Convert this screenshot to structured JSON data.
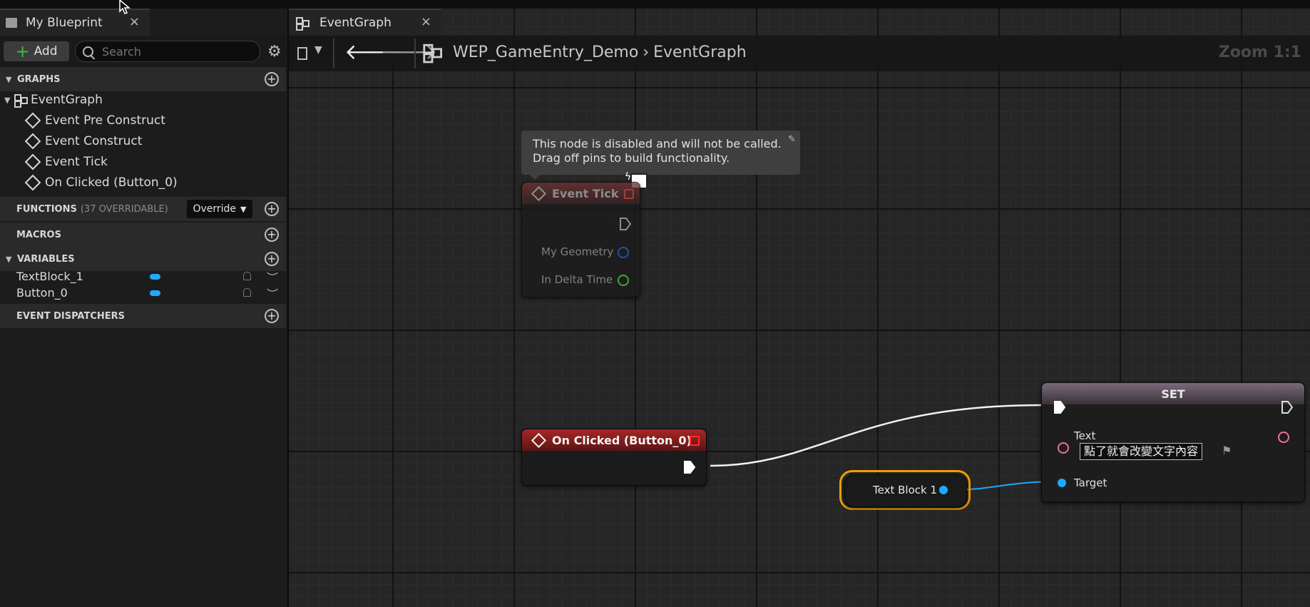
{
  "my_blueprint": {
    "tab_title": "My Blueprint",
    "close_symbol": "×",
    "add_label": "Add",
    "search_placeholder": "Search",
    "sections": {
      "graphs": "GRAPHS",
      "functions": "FUNCTIONS",
      "functions_count": "(37 OVERRIDABLE)",
      "override_label": "Override",
      "macros": "MACROS",
      "variables": "VARIABLES",
      "event_dispatchers": "EVENT DISPATCHERS"
    },
    "graph_root": "EventGraph",
    "events": [
      "Event Pre Construct",
      "Event Construct",
      "Event Tick",
      "On Clicked (Button_0)"
    ],
    "variables": [
      "TextBlock_1",
      "Button_0"
    ]
  },
  "graph": {
    "tab_title": "EventGraph",
    "close_symbol": "×",
    "breadcrumb": [
      "WEP_GameEntry_Demo",
      "EventGraph"
    ],
    "zoom": "Zoom 1:1"
  },
  "tooltip": {
    "line1": "This node is disabled and will not be called.",
    "line2": "Drag off pins to build functionality."
  },
  "nodes": {
    "event_tick": {
      "title": "Event Tick",
      "pins": [
        "My Geometry",
        "In Delta Time"
      ]
    },
    "on_clicked": {
      "title": "On Clicked (Button_0)"
    },
    "set": {
      "title": "SET",
      "text_pin": "Text",
      "text_value": "點了就會改變文字內容",
      "target_pin": "Target"
    },
    "text_block": {
      "label": "Text Block 1"
    }
  },
  "colors": {
    "event_header": "#8f1f1f",
    "text_pin": "#f0709a",
    "object_pin": "#1fa8ff",
    "struct_pin": "#2060c0",
    "float_pin": "#3cd43c",
    "selection": "#f0a000"
  }
}
